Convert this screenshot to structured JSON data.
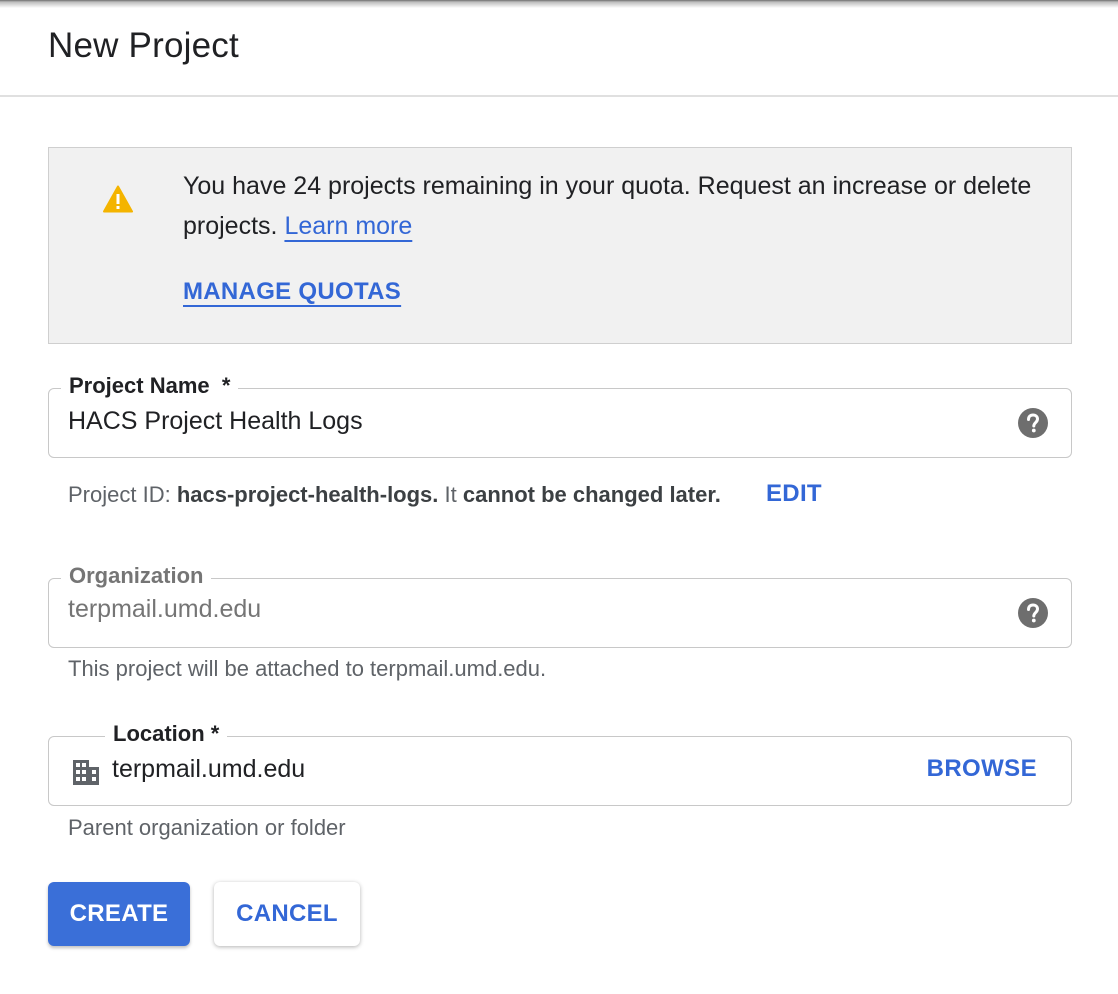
{
  "dialog": {
    "title": "New Project"
  },
  "quota_notice": {
    "message": "You have 24 projects remaining in your quota. Request an increase or delete projects.",
    "learn_more_label": "Learn more",
    "manage_quotas_label": "MANAGE QUOTAS",
    "icon": "warning-icon",
    "icon_color": "#f4b400"
  },
  "project_name": {
    "label": "Project Name",
    "required_mark": "*",
    "value": "HACS Project Health Logs",
    "help_icon": "help-icon"
  },
  "project_id": {
    "prefix": "Project ID: ",
    "id": "hacs-project-health-logs.",
    "middle": " It ",
    "emphasis": "cannot be changed later.",
    "edit_label": "EDIT"
  },
  "organization": {
    "label": "Organization",
    "value": "terpmail.umd.edu",
    "help_icon": "help-icon",
    "helper": "This project will be attached to terpmail.umd.edu."
  },
  "location": {
    "label": "Location",
    "required_mark": "*",
    "value": "terpmail.umd.edu",
    "icon": "building-icon",
    "browse_label": "BROWSE",
    "helper": "Parent organization or folder"
  },
  "actions": {
    "create_label": "CREATE",
    "cancel_label": "CANCEL"
  },
  "colors": {
    "accent": "#3367d6",
    "primary_button": "#3a6fd8",
    "notice_background": "#f1f1f1"
  }
}
